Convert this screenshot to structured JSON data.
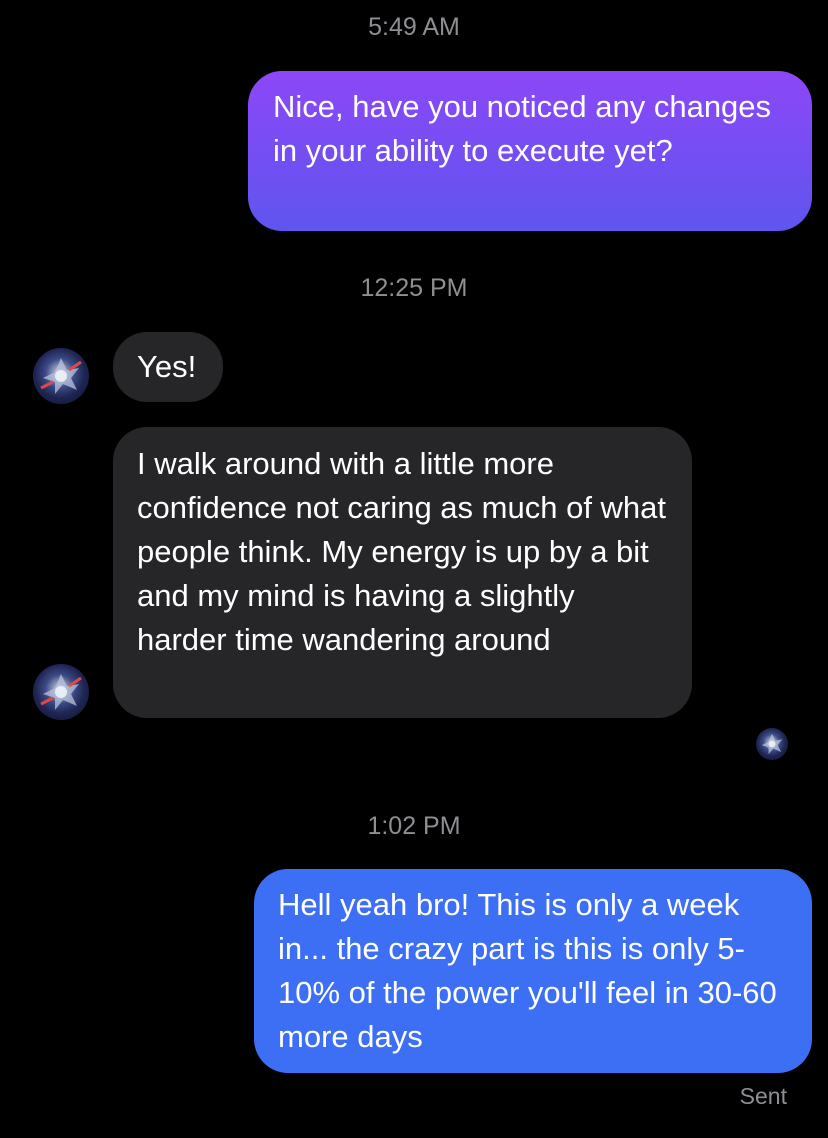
{
  "messages": [
    {
      "type": "timestamp",
      "text": "5:49 AM"
    },
    {
      "type": "outgoing",
      "text": "Nice, have you noticed any changes in your ability to execute yet?"
    },
    {
      "type": "timestamp",
      "text": "12:25 PM"
    },
    {
      "type": "incoming",
      "text": "Yes!"
    },
    {
      "type": "incoming",
      "text": "I walk around with a little more confidence not caring as much of what people think. My energy is up by a bit and my mind is having a slightly harder time wandering around"
    },
    {
      "type": "timestamp",
      "text": "1:02 PM"
    },
    {
      "type": "outgoing",
      "text": "Hell yeah bro! This is only a week in... the crazy part is this is only 5-10% of the power you'll feel in 30-60 more days"
    }
  ],
  "status": "Sent",
  "colors": {
    "background": "#000000",
    "incoming_bubble": "#262628",
    "outgoing_gradient_top": "#8c47f6",
    "outgoing_gradient_bottom": "#5f55ef",
    "outgoing_bubble_blue": "#3d6ff5",
    "timestamp_text": "#8e8e93"
  },
  "icons": {
    "contact_avatar": "contact-avatar",
    "read_receipt": "read-receipt-avatar"
  }
}
